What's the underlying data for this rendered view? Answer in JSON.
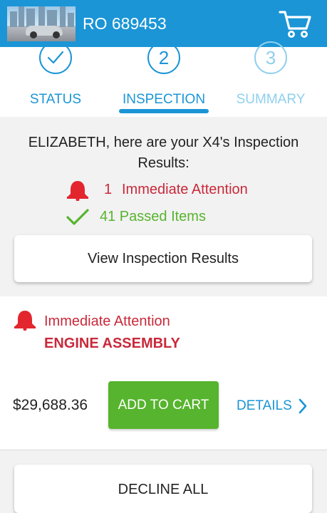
{
  "header": {
    "repair_order": "RO 689453",
    "vehicle_thumbnail_icon": "car-photo",
    "cart_icon": "shopping-cart-icon"
  },
  "steps": [
    {
      "number": "✓",
      "label": "STATUS",
      "state": "done"
    },
    {
      "number": "2",
      "label": "INSPECTION",
      "state": "active"
    },
    {
      "number": "3",
      "label": "SUMMARY",
      "state": "pending"
    }
  ],
  "results": {
    "headline": "ELIZABETH, here are your X4's Inspection Results:",
    "attention_count": "1",
    "attention_label": "Immediate Attention",
    "passed_label": "41 Passed Items",
    "view_button": "View Inspection Results"
  },
  "item": {
    "status": "Immediate Attention",
    "name": "ENGINE ASSEMBLY",
    "price": "$29,688.36",
    "add_button": "ADD TO CART",
    "details_link": "DETAILS"
  },
  "footer": {
    "decline_button": "DECLINE ALL"
  },
  "colors": {
    "brand_blue": "#1b95d6",
    "attention_red": "#c9293a",
    "pass_green": "#57b42e",
    "bell_red": "#e3262e"
  }
}
